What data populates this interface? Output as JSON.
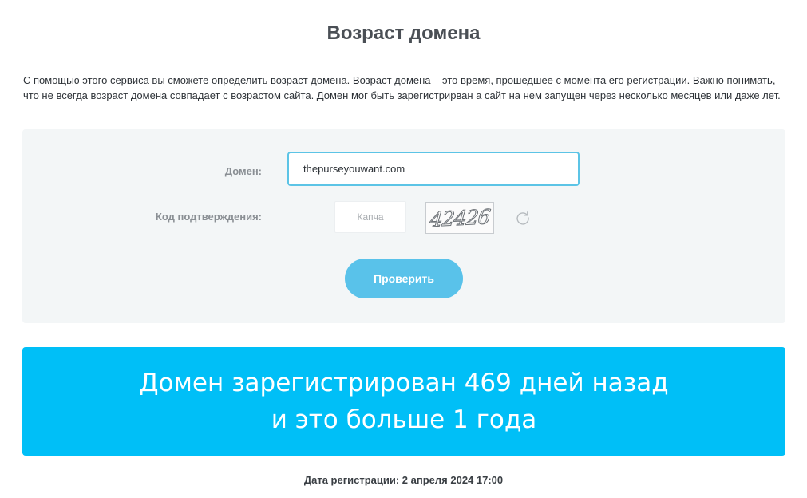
{
  "header": {
    "title": "Возраст домена"
  },
  "intro": {
    "text": "С помощью этого сервиса вы сможете определить возраст домена. Возраст домена – это время, прошедшее с момента его регистрации. Важно понимать, что не всегда возраст домена совпадает с возрастом сайта. Домен мог быть зарегистрирван а сайт на нем запущен через несколько месяцев или даже лет."
  },
  "form": {
    "domain_label": "Домен:",
    "domain_value": "thepurseyouwant.com",
    "captcha_label": "Код подтверждения:",
    "captcha_placeholder": "Капча",
    "captcha_image_text": "42426",
    "refresh_icon": "refresh-icon",
    "submit_label": "Проверить"
  },
  "result": {
    "line1": "Домен зарегистрирован 469 дней назад",
    "line2": "и это больше 1 года",
    "registration_date": "Дата регистрации: 2 апреля 2024 17:00"
  },
  "colors": {
    "result_background": "#00bff7",
    "button_background": "#59c2ea",
    "input_border": "#5cc4e6",
    "panel_background": "#f3f6f7"
  }
}
